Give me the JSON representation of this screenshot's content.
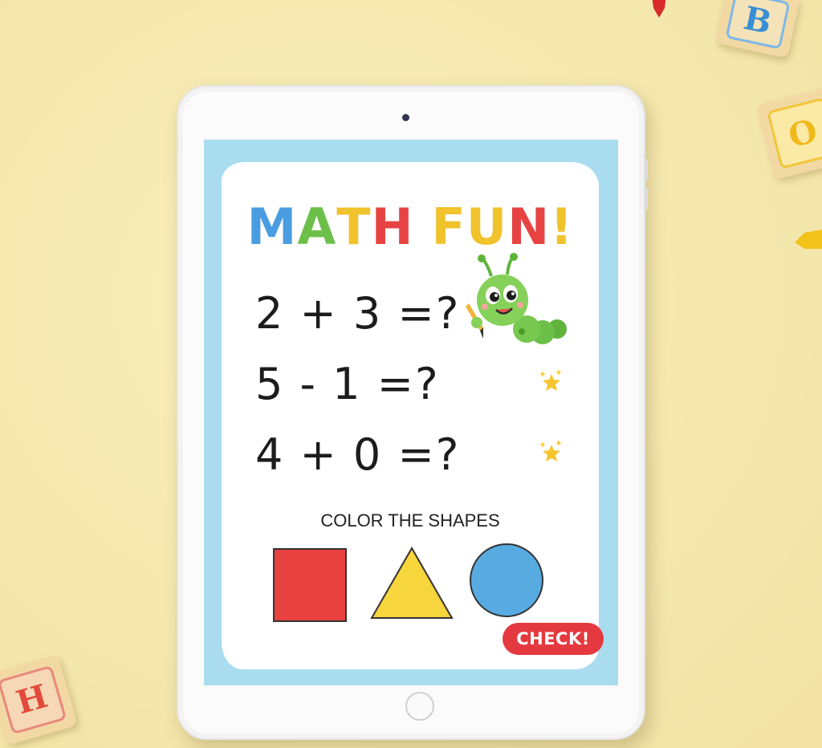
{
  "title": {
    "letters": [
      {
        "char": "M",
        "color": "#4a9de0"
      },
      {
        "char": "A",
        "color": "#6cc04a"
      },
      {
        "char": "T",
        "color": "#f0c22b"
      },
      {
        "char": "H",
        "color": "#e84343"
      },
      {
        "char": " ",
        "color": "#ffffff"
      },
      {
        "char": "F",
        "color": "#f0c22b"
      },
      {
        "char": "U",
        "color": "#f0c22b"
      },
      {
        "char": "N",
        "color": "#e84343"
      },
      {
        "char": "!",
        "color": "#f0c22b"
      }
    ],
    "text": "MATH FUN!"
  },
  "problems": [
    "2 + 3 =?",
    "5 - 1 =?",
    "4 + 0 =?"
  ],
  "shapes_section": {
    "label": "COLOR THE SHAPES",
    "shapes": [
      {
        "name": "square",
        "color": "#e84140"
      },
      {
        "name": "triangle",
        "color": "#f7d53c"
      },
      {
        "name": "circle",
        "color": "#57abe1"
      }
    ]
  },
  "check_button": {
    "label": "CHECK!",
    "color": "#e4393f"
  },
  "icons": [
    "caterpillar-mascot-icon",
    "star-icon",
    "camera-icon",
    "home-button-icon"
  ],
  "blocks": [
    {
      "letter": "B",
      "color": "#3a8fd4"
    },
    {
      "letter": "O",
      "color": "#f0c22b"
    },
    {
      "letter": "H",
      "color": "#e24b3b"
    }
  ]
}
